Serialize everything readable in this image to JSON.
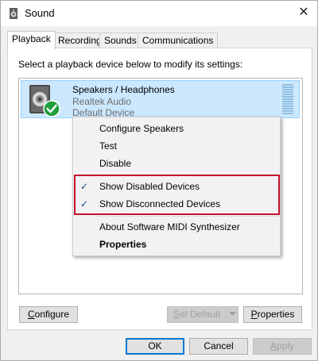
{
  "window": {
    "title": "Sound",
    "close_glyph": "✕"
  },
  "tabs": [
    {
      "label": "Playback",
      "active": true
    },
    {
      "label": "Recording",
      "active": false
    },
    {
      "label": "Sounds",
      "active": false
    },
    {
      "label": "Communications",
      "active": false
    }
  ],
  "playback": {
    "instructions": "Select a playback device below to modify its settings:",
    "device": {
      "name": "Speakers / Headphones",
      "driver": "Realtek Audio",
      "status": "Default Device",
      "status_icon": "green-check-icon"
    }
  },
  "context_menu": {
    "items": [
      {
        "label": "Configure Speakers",
        "checked": false,
        "bold": false
      },
      {
        "label": "Test",
        "checked": false,
        "bold": false
      },
      {
        "label": "Disable",
        "checked": false,
        "bold": false
      },
      {
        "label": "Show Disabled Devices",
        "checked": true,
        "bold": false
      },
      {
        "label": "Show Disconnected Devices",
        "checked": true,
        "bold": false
      },
      {
        "label": "About Software MIDI Synthesizer",
        "checked": false,
        "bold": false
      },
      {
        "label": "Properties",
        "checked": false,
        "bold": true
      }
    ],
    "check_glyph": "✓",
    "highlight_color": "#c8102e"
  },
  "panel_buttons": {
    "configure": {
      "mnemonic": "C",
      "rest": "onfigure"
    },
    "set_default": {
      "mnemonic": "S",
      "rest": "et Default",
      "enabled": false
    },
    "properties": {
      "mnemonic": "P",
      "rest": "roperties"
    }
  },
  "dialog_buttons": {
    "ok": "OK",
    "cancel": "Cancel",
    "apply": {
      "mnemonic": "A",
      "rest": "pply",
      "enabled": false
    }
  },
  "colors": {
    "selection": "#cce8ff",
    "accent": "#0078d7",
    "check_green": "#1e9e3c"
  }
}
